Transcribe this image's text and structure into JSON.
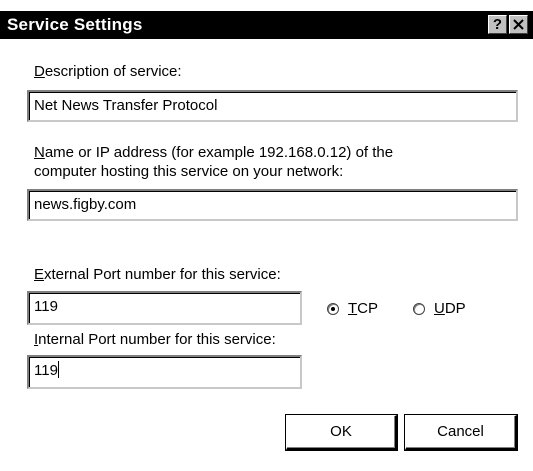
{
  "window": {
    "title": "Service Settings",
    "help_button": "?",
    "close_button": "✕"
  },
  "description": {
    "label_first": "D",
    "label_rest": "escription of service:",
    "value": "Net News Transfer Protocol"
  },
  "host": {
    "label_line1_first": "N",
    "label_line1_rest": "ame or IP address (for example 192.168.0.12) of the",
    "label_line2": "computer hosting this service on your network:",
    "value": "news.figby.com"
  },
  "external_port": {
    "label_first": "E",
    "label_rest": "xternal Port number for this service:",
    "value": "119"
  },
  "internal_port": {
    "label_first": "I",
    "label_rest": "nternal Port number for this service:",
    "value": "119"
  },
  "protocol": {
    "selected": "TCP",
    "tcp_first": "T",
    "tcp_rest": "CP",
    "udp_first": "U",
    "udp_rest": "DP"
  },
  "buttons": {
    "ok": "OK",
    "cancel": "Cancel"
  }
}
